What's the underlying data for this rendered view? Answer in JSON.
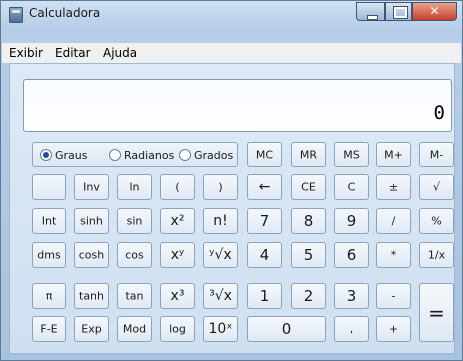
{
  "window": {
    "title": "Calculadora"
  },
  "menu": [
    "Exibir",
    "Editar",
    "Ajuda"
  ],
  "display": {
    "value": "0"
  },
  "angle_mode": {
    "options": [
      "Graus",
      "Radianos",
      "Grados"
    ],
    "selected": "Graus"
  },
  "keys": {
    "memory": [
      "MC",
      "MR",
      "MS",
      "M+",
      "M-"
    ],
    "row1": [
      "Inv",
      "ln",
      "(",
      ")",
      "←",
      "CE",
      "C",
      "±",
      "√"
    ],
    "row2": [
      "Int",
      "sinh",
      "sin",
      "x²",
      "n!",
      "7",
      "8",
      "9",
      "/",
      "%"
    ],
    "row3": [
      "dms",
      "cosh",
      "cos",
      "xʸ",
      "ʸ√x",
      "4",
      "5",
      "6",
      "*",
      "1/x"
    ],
    "row4": [
      "π",
      "tanh",
      "tan",
      "x³",
      "³√x",
      "1",
      "2",
      "3",
      "-",
      "="
    ],
    "row5": [
      "F-E",
      "Exp",
      "Mod",
      "log",
      "10ˣ",
      "0",
      ",",
      "+"
    ]
  }
}
